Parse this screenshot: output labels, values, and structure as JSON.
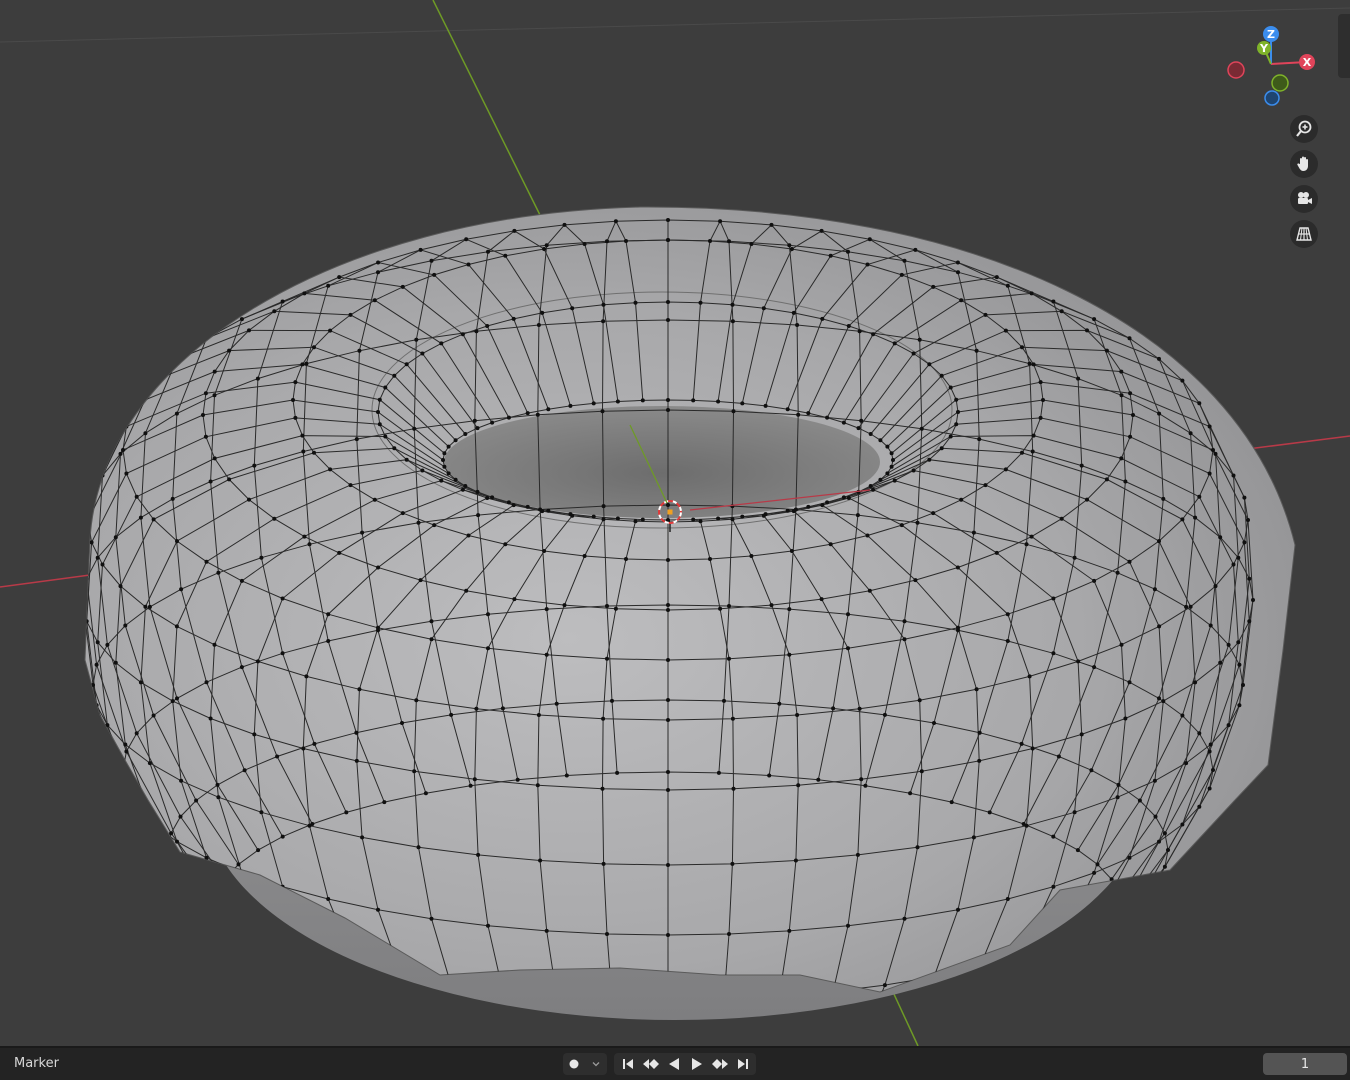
{
  "viewport": {
    "navigation": {
      "gizmo_axes": {
        "x": "X",
        "y": "Y",
        "z": "Z"
      },
      "colors": {
        "x": "#e0445a",
        "y": "#7fb32a",
        "z": "#3b8ded"
      },
      "buttons": [
        {
          "icon": "zoom-icon"
        },
        {
          "icon": "hand-pan-icon"
        },
        {
          "icon": "camera-icon"
        },
        {
          "icon": "perspective-grid-icon"
        }
      ]
    },
    "scene": {
      "object": "torus-donut-mesh",
      "mode": "edit-vertex",
      "axis_colors": {
        "x": "#b83a48",
        "y": "#7aa428"
      }
    }
  },
  "timeline": {
    "marker_label": "Marker",
    "keying": {
      "record_icon": "record-dot-icon",
      "dropdown_icon": "chevron-down-icon"
    },
    "playback_icons": [
      "jump-start-icon",
      "prev-keyframe-icon",
      "play-reverse-icon",
      "play-icon",
      "next-keyframe-icon",
      "jump-end-icon"
    ],
    "current_frame": "1"
  }
}
